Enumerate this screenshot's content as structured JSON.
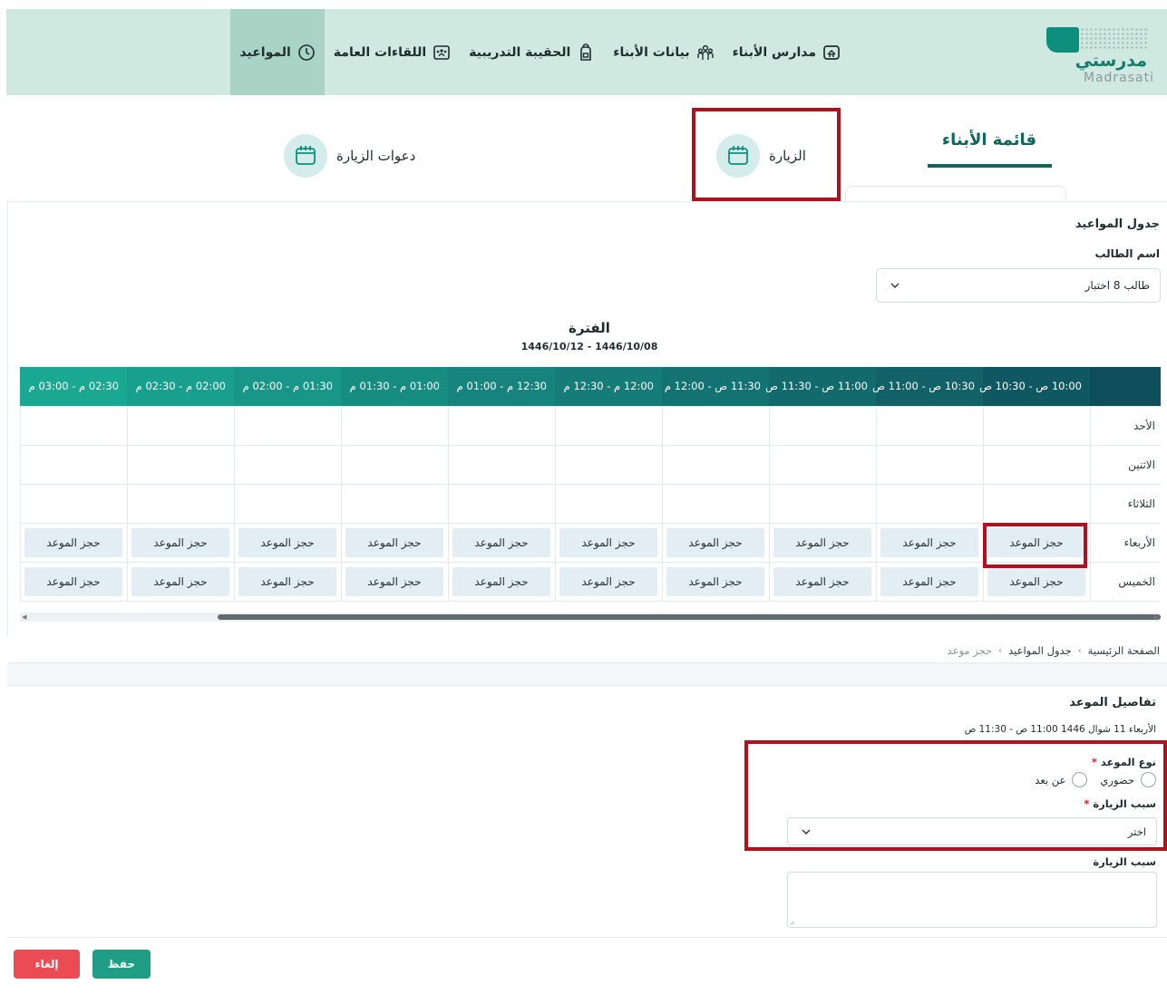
{
  "nav": {
    "logo_ar": "مدرستي",
    "logo_en": "Madrasati",
    "items": [
      {
        "label": "مدارس الأبناء",
        "icon": "school-icon"
      },
      {
        "label": "بيانات الأبناء",
        "icon": "children-icon"
      },
      {
        "label": "الحقيبة التدريبية",
        "icon": "backpack-icon"
      },
      {
        "label": "اللقاءات العامة",
        "icon": "meetings-icon"
      },
      {
        "label": "المواعيد",
        "icon": "clock-icon",
        "active": true
      }
    ]
  },
  "tabs": {
    "sons_list": "قائمة الأبناء",
    "visit": "الزيارة",
    "visit_invites": "دعوات الزيارة"
  },
  "schedule": {
    "title": "جدول المواعيد",
    "student_label": "اسم الطالب",
    "student_value": "طالب 8 اختبار",
    "period_title": "الفترة",
    "period_range": "1446/10/12 - 1446/10/08",
    "time_slots": [
      "10:00 ص - 10:30 ص",
      "10:30 ص - 11:00 ص",
      "11:00 ص - 11:30 ص",
      "11:30 ص - 12:00 م",
      "12:00 م - 12:30 م",
      "12:30 م - 01:00 م",
      "01:00 م - 01:30 م",
      "01:30 م - 02:00 م",
      "02:00 م - 02:30 م",
      "02:30 م - 03:00 م"
    ],
    "days": [
      {
        "name": "الأحد",
        "bookable": false
      },
      {
        "name": "الاثنين",
        "bookable": false
      },
      {
        "name": "الثلاثاء",
        "bookable": false
      },
      {
        "name": "الأربعاء",
        "bookable": true
      },
      {
        "name": "الخميس",
        "bookable": true
      }
    ],
    "book_label": "حجز الموعد"
  },
  "breadcrumb": {
    "home": "الصفحة الرئيسية",
    "schedule": "جدول المواعيد",
    "current": "حجز موعد"
  },
  "details": {
    "title": "تفاصيل الموعد",
    "date": "الأربعاء 11 شوال 1446 11:00 ص - 11:30 ص",
    "type_label": "نوع الموعد",
    "type_options": [
      "حضوري",
      "عن بعد"
    ],
    "reason_label": "سبب الزيارة",
    "reason_placeholder": "اختر",
    "reason_text_label": "سبب الزيارة",
    "save": "حفظ",
    "cancel": "إلغاء"
  },
  "colors": {
    "nav_bg": "#cfe9e0",
    "nav_active": "#a9d4c5",
    "brand": "#0e8f7e",
    "highlight": "#b50e1c",
    "save": "#1f9e85",
    "cancel": "#ea4b55",
    "header_gradient_start": "#0f4f5c",
    "header_gradient_end": "#1aa38f"
  }
}
